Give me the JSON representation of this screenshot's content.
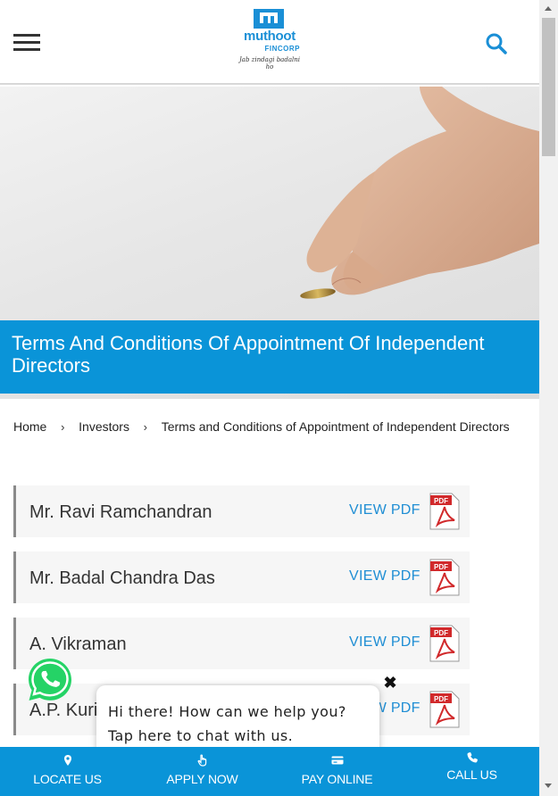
{
  "header": {
    "logo_brand": "muthoot",
    "logo_sub": "FINCORP",
    "logo_tagline": "Jab zindagi badalni ho",
    "menu_icon": "hamburger-menu-icon",
    "search_icon": "search-icon"
  },
  "hero": {
    "title": "Terms And Conditions Of Appointment Of Independent Directors"
  },
  "breadcrumb": {
    "items": [
      "Home",
      "Investors",
      "Terms and Conditions of Appointment of Independent Directors"
    ],
    "separator": "›"
  },
  "documents": [
    {
      "name": "Mr. Ravi Ramchandran",
      "link_label": "VIEW PDF"
    },
    {
      "name": "Mr. Badal Chandra Das",
      "link_label": "VIEW PDF"
    },
    {
      "name": "A. Vikraman",
      "link_label": "VIEW PDF"
    },
    {
      "name": "A.P. Kuri",
      "link_label": "VIEW PDF"
    }
  ],
  "chat": {
    "message": "Hi there! How can we help you? Tap here to chat with us.",
    "close_label": "✖"
  },
  "bottom_nav": {
    "locate": "LOCATE US",
    "apply": "APPLY NOW",
    "pay": "PAY ONLINE",
    "call": "CALL US"
  },
  "colors": {
    "accent": "#0a94d8",
    "link": "#1f8ed4",
    "pdf_red": "#d1292b",
    "whatsapp": "#25d366"
  }
}
